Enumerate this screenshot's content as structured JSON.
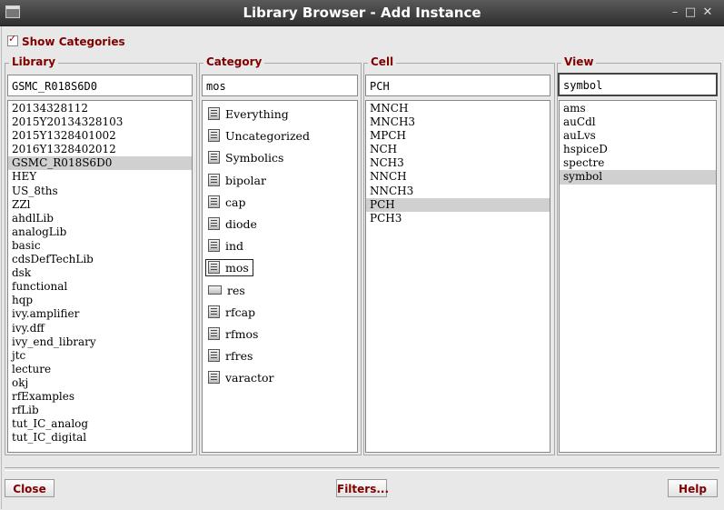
{
  "window": {
    "title": "Library Browser - Add Instance",
    "minimize": "–",
    "maximize": "□",
    "close": "✕"
  },
  "show_categories": {
    "label": "Show Categories",
    "checked": true
  },
  "library": {
    "label": "Library",
    "filter": "GSMC_R018S6D0",
    "items": [
      "20134328112",
      "2015Y20134328103",
      "2015Y1328401002",
      "2016Y1328402012",
      "GSMC_R018S6D0",
      "HEY",
      "US_8ths",
      "ZZl",
      "ahdlLib",
      "analogLib",
      "basic",
      "cdsDefTechLib",
      "dsk",
      "functional",
      "hqp",
      "ivy.amplifier",
      "ivy.dff",
      "ivy_end_library",
      "jtc",
      "lecture",
      "okj",
      "rfExamples",
      "rfLib",
      "tut_IC_analog",
      "tut_IC_digital"
    ],
    "selected": "GSMC_R018S6D0"
  },
  "category": {
    "label": "Category",
    "filter": "mos",
    "items": [
      "Everything",
      "Uncategorized",
      "Symbolics",
      "bipolar",
      "cap",
      "diode",
      "ind",
      "mos",
      "res",
      "rfcap",
      "rfmos",
      "rfres",
      "varactor"
    ],
    "selected": "mos"
  },
  "cell": {
    "label": "Cell",
    "filter": "PCH",
    "items": [
      "MNCH",
      "MNCH3",
      "MPCH",
      "NCH",
      "NCH3",
      "NNCH",
      "NNCH3",
      "PCH",
      "PCH3"
    ],
    "selected": "PCH"
  },
  "view": {
    "label": "View",
    "filter": "symbol",
    "items": [
      "ams",
      "auCdl",
      "auLvs",
      "hspiceD",
      "spectre",
      "symbol"
    ],
    "selected": "symbol"
  },
  "buttons": {
    "close": "Close",
    "filters": "Filters...",
    "help": "Help"
  }
}
